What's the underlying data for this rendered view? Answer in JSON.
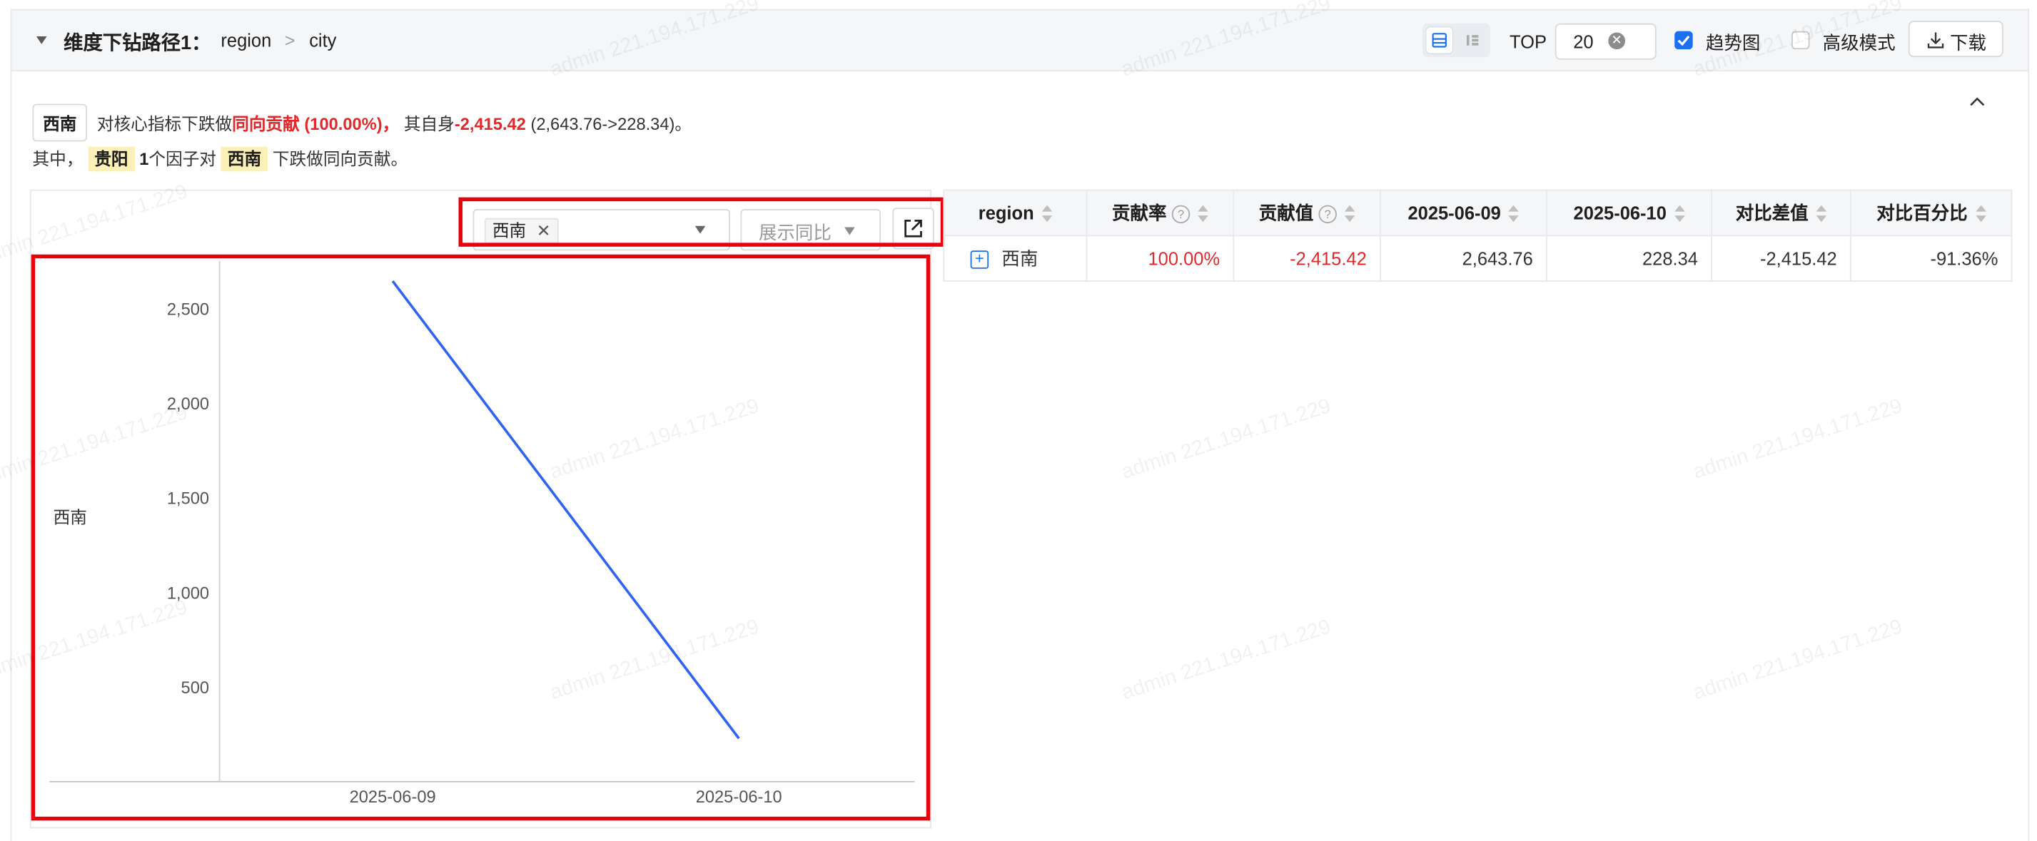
{
  "header": {
    "title": "维度下钻路径1：",
    "path": [
      "region",
      "city"
    ],
    "path_separator": ">",
    "top_label": "TOP",
    "top_value": "20",
    "trend_label": "趋势图",
    "trend_checked": true,
    "advanced_label": "高级模式",
    "advanced_checked": false,
    "download_label": "下载"
  },
  "summary": {
    "region_tag": "西南",
    "text1": "对核心指标下跌做",
    "positive_contribution": "同向贡献 (100.00%)，",
    "text2": "其自身",
    "self_value": "-2,415.42",
    "self_range": "(2,643.76->228.34)。",
    "line2_prefix": "其中，",
    "factor_city": "贵阳",
    "factor_count": "1",
    "line2_mid": "个因子对",
    "target_region": "西南",
    "line2_suffix": "下跌做同向贡献。"
  },
  "chart_toolbar": {
    "selected_region": "西南",
    "yoy_label": "展示同比"
  },
  "chart_data": {
    "type": "line",
    "x": [
      "2025-06-09",
      "2025-06-10"
    ],
    "series": [
      {
        "name": "西南",
        "values": [
          2643.76,
          228.34
        ],
        "color": "#2f63f0"
      }
    ],
    "yticks": [
      500,
      1000,
      1500,
      2000,
      2500
    ],
    "ytick_labels": [
      "500",
      "1,000",
      "1,500",
      "2,000",
      "2,500"
    ],
    "ylim": [
      0,
      2750
    ],
    "ylabel": "西南",
    "grid": false
  },
  "table": {
    "headers": [
      "region",
      "贡献率",
      "贡献值",
      "2025-06-09",
      "2025-06-10",
      "对比差值",
      "对比百分比"
    ],
    "rows": [
      {
        "region": "西南",
        "rate": "100.00%",
        "value": "-2,415.42",
        "d1": "2,643.76",
        "d2": "228.34",
        "diff": "-2,415.42",
        "pct": "-91.36%"
      }
    ]
  },
  "watermark": "admin 221.194.171.229",
  "colors": {
    "accent": "#1d6ff2",
    "negative": "#e0292b",
    "highlight_border": "#e8000b",
    "line": "#2f63f0"
  }
}
